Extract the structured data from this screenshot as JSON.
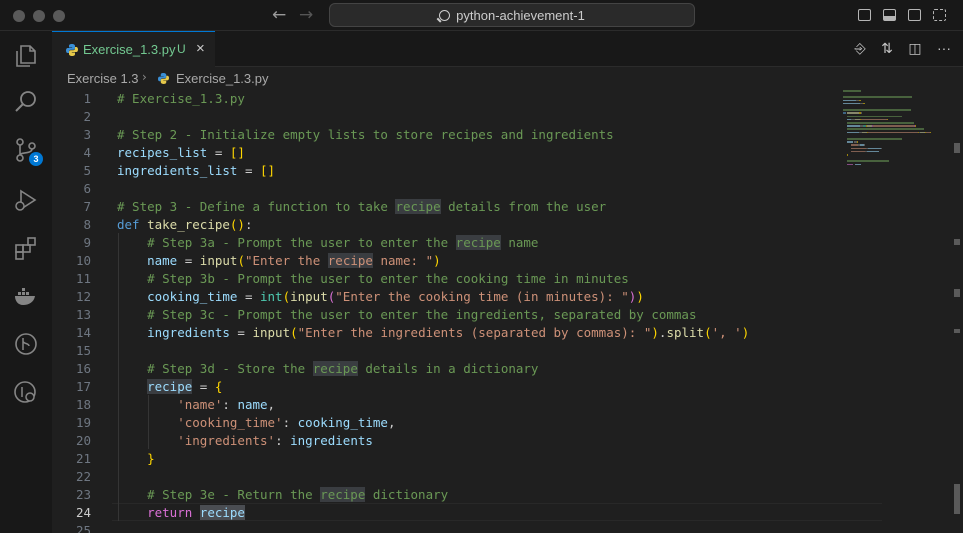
{
  "window": {
    "search_text": "python-achievement-1",
    "back_icon": "arrow-left",
    "forward_icon": "arrow-right"
  },
  "activity_bar": {
    "items": [
      "explorer",
      "search",
      "source-control",
      "run-debug",
      "extensions",
      "docker",
      "git-graph",
      "remote"
    ],
    "source_control_badge": "3"
  },
  "tab": {
    "name": "Exercise_1.3.py",
    "status": "U",
    "close": "×"
  },
  "breadcrumbs": {
    "folder": "Exercise 1.3",
    "file": "Exercise_1.3.py"
  },
  "editor": {
    "active_line": 24,
    "lines": [
      {
        "n": "1",
        "tokens": [
          [
            "c",
            "# Exercise_1.3.py"
          ]
        ]
      },
      {
        "n": "2",
        "tokens": []
      },
      {
        "n": "3",
        "tokens": [
          [
            "c",
            "# Step 2 - Initialize empty lists to store recipes and ingredients"
          ]
        ]
      },
      {
        "n": "4",
        "tokens": [
          [
            "v",
            "recipes_list"
          ],
          [
            "",
            " = "
          ],
          [
            "y",
            "[]"
          ]
        ]
      },
      {
        "n": "5",
        "tokens": [
          [
            "v",
            "ingredients_list"
          ],
          [
            "",
            " = "
          ],
          [
            "y",
            "[]"
          ]
        ]
      },
      {
        "n": "6",
        "tokens": []
      },
      {
        "n": "7",
        "tokens": [
          [
            "c",
            "# Step 3 - Define a function to take "
          ],
          [
            "c hl",
            "recipe"
          ],
          [
            "c",
            " details from the user"
          ]
        ]
      },
      {
        "n": "8",
        "tokens": [
          [
            "k",
            "def"
          ],
          [
            "",
            " "
          ],
          [
            "f",
            "take_recipe"
          ],
          [
            "y",
            "()"
          ],
          [
            "",
            ":"
          ]
        ]
      },
      {
        "n": "9",
        "tokens": [
          [
            "",
            "    "
          ],
          [
            "c",
            "# Step 3a - Prompt the user to enter the "
          ],
          [
            "c hl",
            "recipe"
          ],
          [
            "c",
            " name"
          ]
        ]
      },
      {
        "n": "10",
        "tokens": [
          [
            "",
            "    "
          ],
          [
            "v",
            "name"
          ],
          [
            "",
            " = "
          ],
          [
            "f",
            "input"
          ],
          [
            "y",
            "("
          ],
          [
            "s",
            "\"Enter the "
          ],
          [
            "s hl",
            "recipe"
          ],
          [
            "s",
            " name: \""
          ],
          [
            "y",
            ")"
          ]
        ]
      },
      {
        "n": "11",
        "tokens": [
          [
            "",
            "    "
          ],
          [
            "c",
            "# Step 3b - Prompt the user to enter the cooking time in minutes"
          ]
        ]
      },
      {
        "n": "12",
        "tokens": [
          [
            "",
            "    "
          ],
          [
            "v",
            "cooking_time"
          ],
          [
            "",
            " = "
          ],
          [
            "b",
            "int"
          ],
          [
            "y",
            "("
          ],
          [
            "f",
            "input"
          ],
          [
            "p",
            "("
          ],
          [
            "s",
            "\"Enter the cooking time (in minutes): \""
          ],
          [
            "p",
            ")"
          ],
          [
            "y",
            ")"
          ]
        ]
      },
      {
        "n": "13",
        "tokens": [
          [
            "",
            "    "
          ],
          [
            "c",
            "# Step 3c - Prompt the user to enter the ingredients, separated by commas"
          ]
        ]
      },
      {
        "n": "14",
        "tokens": [
          [
            "",
            "    "
          ],
          [
            "v",
            "ingredients"
          ],
          [
            "",
            " = "
          ],
          [
            "f",
            "input"
          ],
          [
            "y",
            "("
          ],
          [
            "s",
            "\"Enter the ingredients (separated by commas): \""
          ],
          [
            "y",
            ")"
          ],
          [
            "",
            "."
          ],
          [
            "f",
            "split"
          ],
          [
            "y",
            "("
          ],
          [
            "s",
            "', '"
          ],
          [
            "y",
            ")"
          ]
        ]
      },
      {
        "n": "15",
        "tokens": []
      },
      {
        "n": "16",
        "tokens": [
          [
            "",
            "    "
          ],
          [
            "c",
            "# Step 3d - Store the "
          ],
          [
            "c hl",
            "recipe"
          ],
          [
            "c",
            " details in a dictionary"
          ]
        ]
      },
      {
        "n": "17",
        "tokens": [
          [
            "",
            "    "
          ],
          [
            "v hl",
            "recipe"
          ],
          [
            "",
            " = "
          ],
          [
            "y",
            "{"
          ]
        ]
      },
      {
        "n": "18",
        "tokens": [
          [
            "",
            "        "
          ],
          [
            "s",
            "'name'"
          ],
          [
            "",
            ": "
          ],
          [
            "v",
            "name"
          ],
          [
            "",
            ","
          ]
        ]
      },
      {
        "n": "19",
        "tokens": [
          [
            "",
            "        "
          ],
          [
            "s",
            "'cooking_time'"
          ],
          [
            "",
            ": "
          ],
          [
            "v",
            "cooking_time"
          ],
          [
            "",
            ","
          ]
        ]
      },
      {
        "n": "20",
        "tokens": [
          [
            "",
            "        "
          ],
          [
            "s",
            "'ingredients'"
          ],
          [
            "",
            ": "
          ],
          [
            "v",
            "ingredients"
          ]
        ]
      },
      {
        "n": "21",
        "tokens": [
          [
            "",
            "    "
          ],
          [
            "y",
            "}"
          ]
        ]
      },
      {
        "n": "22",
        "tokens": []
      },
      {
        "n": "23",
        "tokens": [
          [
            "",
            "    "
          ],
          [
            "c",
            "# Step 3e - Return the "
          ],
          [
            "c hl",
            "recipe"
          ],
          [
            "c",
            " dictionary"
          ]
        ]
      },
      {
        "n": "24",
        "tokens": [
          [
            "",
            "    "
          ],
          [
            "p",
            "return"
          ],
          [
            "",
            " "
          ],
          [
            "v hl2",
            "recipe"
          ]
        ]
      },
      {
        "n": "25",
        "tokens": []
      }
    ]
  },
  "colors": {
    "accent": "#0078d4",
    "untracked": "#73c991",
    "comment": "#6a9955",
    "keyword": "#569cd6",
    "function": "#dcdcaa",
    "string": "#ce9178",
    "variable": "#9cdcfe"
  }
}
